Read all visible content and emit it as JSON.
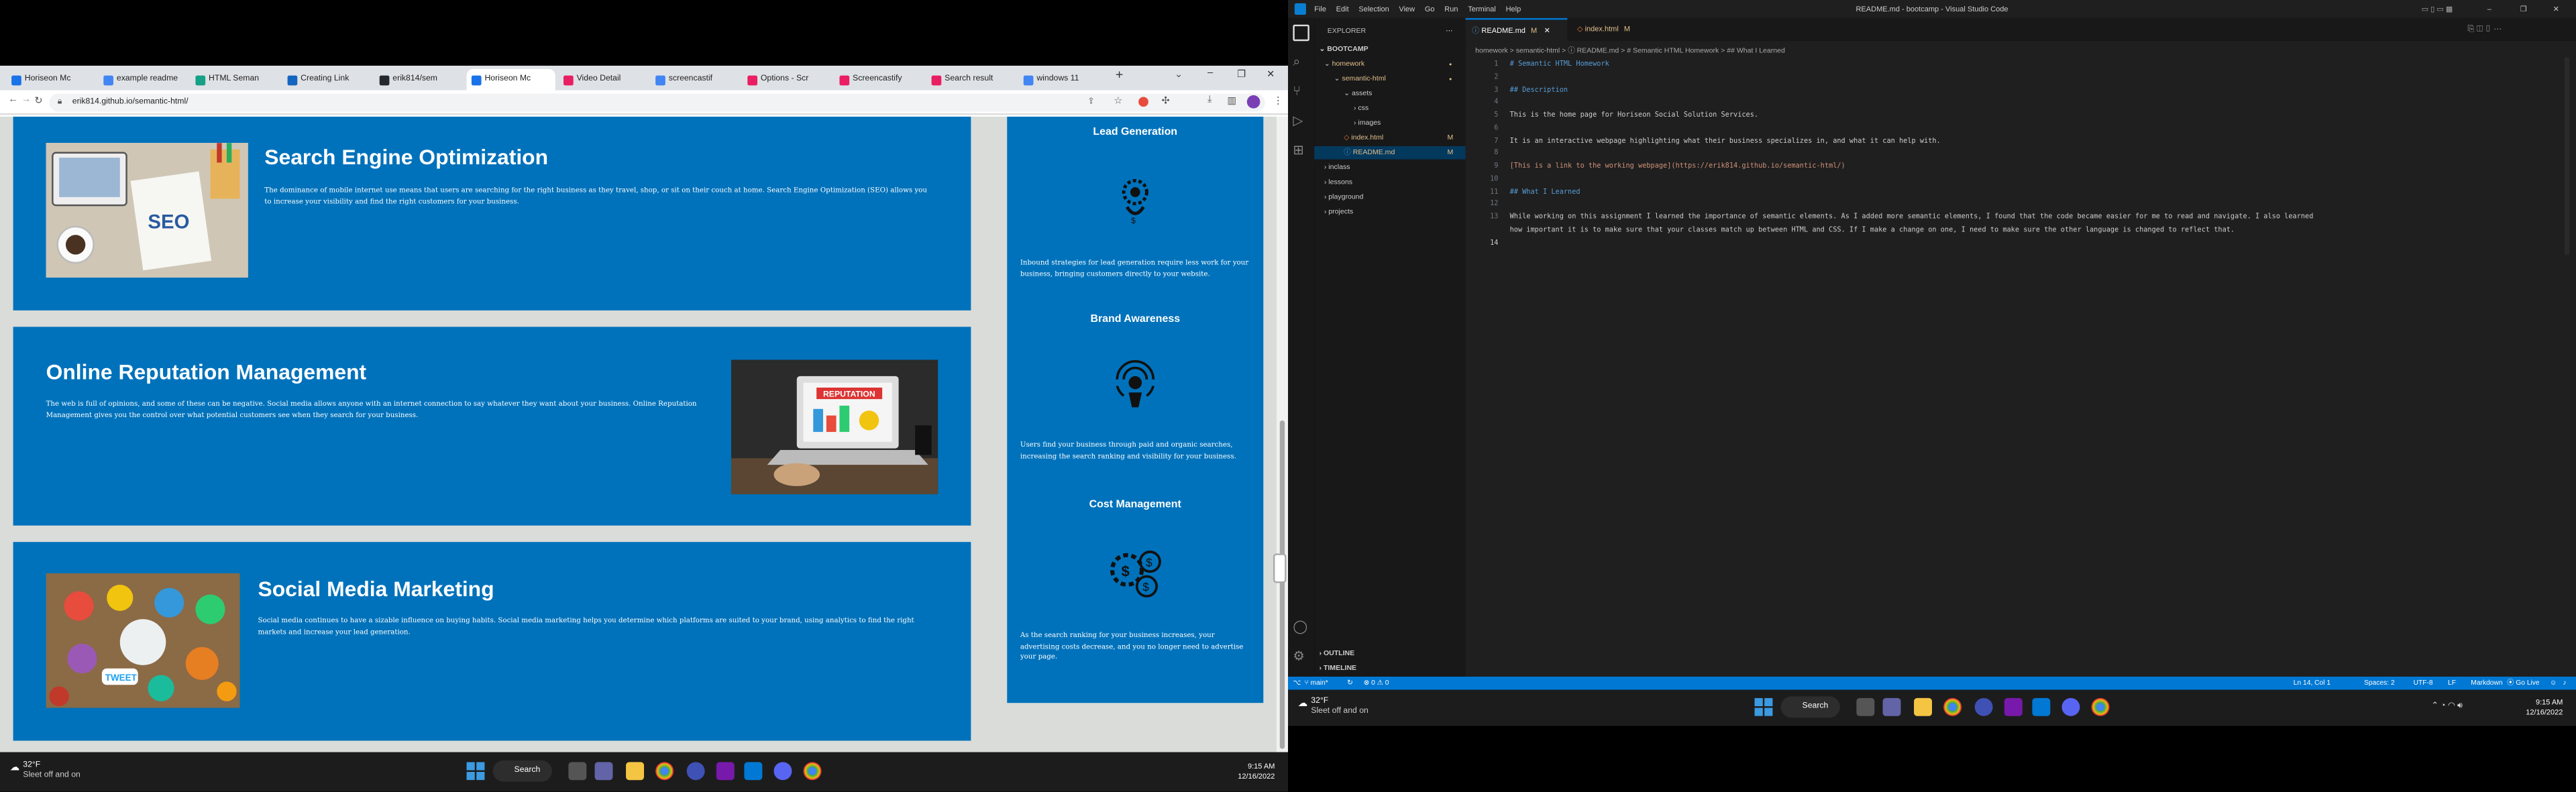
{
  "left_monitor": {
    "browser": {
      "tabs": [
        {
          "label": "Horiseon Mc",
          "color": "#1a73e8"
        },
        {
          "label": "example readme",
          "color": "#4285f4"
        },
        {
          "label": "HTML Seman",
          "color": "#16a085"
        },
        {
          "label": "Creating Link",
          "color": "#1565c0"
        },
        {
          "label": "erik814/sem",
          "color": "#24292f"
        },
        {
          "label": "Horiseon Mc",
          "color": "#1a73e8",
          "active": true
        },
        {
          "label": "Video Detail",
          "color": "#e91e63"
        },
        {
          "label": "screencastif",
          "color": "#4285f4"
        },
        {
          "label": "Options - Scr",
          "color": "#e91e63"
        },
        {
          "label": "Screencastify",
          "color": "#e91e63"
        },
        {
          "label": "Search result",
          "color": "#e91e63"
        },
        {
          "label": "windows 11",
          "color": "#4285f4"
        }
      ],
      "url": "erik814.github.io/semantic-html/"
    },
    "page": {
      "cards": [
        {
          "title": "Search Engine Optimization",
          "text": "The dominance of mobile internet use means that users are searching for the right business as they travel, shop, or sit on their couch at home. Search Engine Optimization (SEO) allows you to increase your visibility and find the right customers for your business."
        },
        {
          "title": "Online Reputation Management",
          "text": "The web is full of opinions, and some of these can be negative. Social media allows anyone with an internet connection to say whatever they want about your business. Online Reputation Management gives you the control over what potential customers see when they search for your business."
        },
        {
          "title": "Social Media Marketing",
          "text": "Social media continues to have a sizable influence on buying habits. Social media marketing helps you determine which platforms are suited to your brand, using analytics to find the right markets and increase your lead generation."
        }
      ],
      "aside": [
        {
          "title": "Lead Generation",
          "text": "Inbound strategies for lead generation require less work for your business, bringing customers directly to your website."
        },
        {
          "title": "Brand Awareness",
          "text": "Users find your business through paid and organic searches, increasing the search ranking and visibility for your business."
        },
        {
          "title": "Cost Management",
          "text": "As the search ranking for your business increases, your advertising costs decrease, and you no longer need to advertise your page."
        }
      ]
    },
    "taskbar": {
      "temp": "32°F",
      "weather": "Sleet off and on",
      "search": "Search",
      "time": "9:15 AM",
      "date": "12/16/2022"
    }
  },
  "right_monitor": {
    "vscode": {
      "menu": [
        "File",
        "Edit",
        "Selection",
        "View",
        "Go",
        "Run",
        "Terminal",
        "Help"
      ],
      "window_title": "README.md - bootcamp - Visual Studio Code",
      "explorer_title": "EXPLORER",
      "workspace": "BOOTCAMP",
      "tree": [
        {
          "label": "homework",
          "depth": 0,
          "type": "folder-open",
          "color": "#e2c08d"
        },
        {
          "label": "semantic-html",
          "depth": 1,
          "type": "folder-open",
          "color": "#e2c08d"
        },
        {
          "label": "assets",
          "depth": 2,
          "type": "folder-open",
          "color": "#cccccc"
        },
        {
          "label": "css",
          "depth": 3,
          "type": "folder",
          "color": "#cccccc"
        },
        {
          "label": "images",
          "depth": 3,
          "type": "folder",
          "color": "#cccccc"
        },
        {
          "label": "index.html",
          "depth": 2,
          "type": "file",
          "color": "#e2c08d",
          "badge": "M"
        },
        {
          "label": "README.md",
          "depth": 2,
          "type": "file",
          "color": "#e2c08d",
          "badge": "M",
          "selected": true
        },
        {
          "label": "inclass",
          "depth": 0,
          "type": "folder",
          "color": "#cccccc"
        },
        {
          "label": "lessons",
          "depth": 0,
          "type": "folder",
          "color": "#cccccc"
        },
        {
          "label": "playground",
          "depth": 0,
          "type": "folder",
          "color": "#cccccc"
        },
        {
          "label": "projects",
          "depth": 0,
          "type": "folder",
          "color": "#cccccc"
        }
      ],
      "outline": "OUTLINE",
      "timeline": "TIMELINE",
      "editor_tabs": [
        {
          "label": "README.md",
          "badge": "M",
          "active": true
        },
        {
          "label": "index.html",
          "badge": "M",
          "active": false
        }
      ],
      "breadcrumbs": "homework > semantic-html > ⓘ README.md > # Semantic HTML Homework > ## What I Learned",
      "code_lines": [
        {
          "n": "1",
          "text": "# Semantic HTML Homework",
          "color": "#569cd6"
        },
        {
          "n": "2",
          "text": "",
          "color": "#cccccc"
        },
        {
          "n": "3",
          "text": "## Description",
          "color": "#569cd6"
        },
        {
          "n": "4",
          "text": "",
          "color": "#cccccc"
        },
        {
          "n": "5",
          "text": "This is the home page for Horiseon Social Solution Services.",
          "color": "#cccccc"
        },
        {
          "n": "6",
          "text": "",
          "color": "#cccccc"
        },
        {
          "n": "7",
          "text": "It is an interactive webpage highlighting what their business specializes in, and what it can help with.",
          "color": "#cccccc"
        },
        {
          "n": "8",
          "text": "",
          "color": "#cccccc"
        },
        {
          "n": "9",
          "text": "[This is a link to the working webpage](https://erik814.github.io/semantic-html/)",
          "color": "#ce9178"
        },
        {
          "n": "10",
          "text": "",
          "color": "#cccccc"
        },
        {
          "n": "11",
          "text": "## What I Learned",
          "color": "#569cd6"
        },
        {
          "n": "12",
          "text": "",
          "color": "#cccccc"
        },
        {
          "n": "13",
          "text": "While working on this assignment I learned the importance of semantic elements. As I added more semantic elements, I found that the code became easier for me to read and navigate. I also learned",
          "color": "#cccccc"
        },
        {
          "n": "",
          "text": "how important it is to make sure that your classes match up between HTML and CSS. If I make a change on one, I need to make sure the other language is changed to reflect that.",
          "color": "#cccccc"
        },
        {
          "n": "14",
          "text": "",
          "color": "#cccccc"
        }
      ],
      "status": {
        "branch": "main*",
        "problems": "⊗ 0 ⚠ 0",
        "position": "Ln 14, Col 1",
        "spaces": "Spaces: 2",
        "encoding": "UTF-8",
        "eol": "LF",
        "language": "Markdown",
        "golive": "Go Live"
      }
    },
    "taskbar": {
      "temp": "32°F",
      "weather": "Sleet off and on",
      "search": "Search",
      "time": "9:15 AM",
      "date": "12/16/2022"
    }
  }
}
